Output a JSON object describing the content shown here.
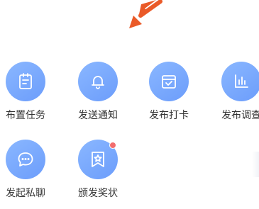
{
  "accent": {
    "circle_gradient": [
      "#8ab7ff",
      "#6c9dfb"
    ],
    "arrow": "#ea5a28",
    "badge": "#f26d6d"
  },
  "tiles": [
    {
      "label": "布置任务",
      "icon": "clipboard-icon"
    },
    {
      "label": "发送通知",
      "icon": "bell-icon"
    },
    {
      "label": "发布打卡",
      "icon": "calendar-check-icon"
    },
    {
      "label": "发布调查",
      "icon": "bar-chart-icon"
    },
    {
      "label": "发起私聊",
      "icon": "chat-bubble-icon"
    },
    {
      "label": "颁发奖状",
      "icon": "award-ribbon-icon",
      "badge": true
    }
  ]
}
